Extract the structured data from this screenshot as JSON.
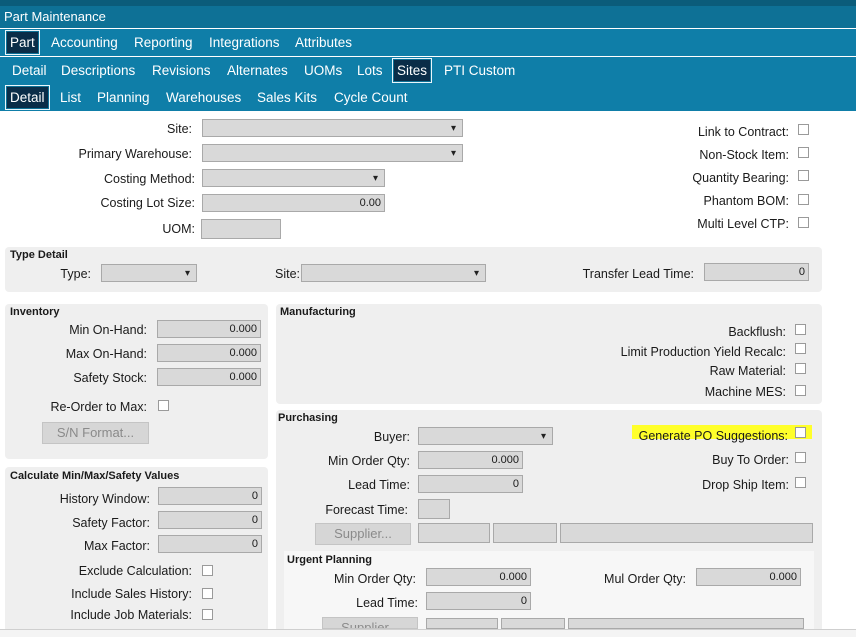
{
  "window": {
    "title": "Part Maintenance"
  },
  "tabs_level1": [
    "Part",
    "Accounting",
    "Reporting",
    "Integrations",
    "Attributes"
  ],
  "tabs_level2": [
    "Detail",
    "Descriptions",
    "Revisions",
    "Alternates",
    "UOMs",
    "Lots",
    "Sites",
    "PTI Custom"
  ],
  "tabs_level3": [
    "Detail",
    "List",
    "Planning",
    "Warehouses",
    "Sales Kits",
    "Cycle Count"
  ],
  "top": {
    "site_label": "Site:",
    "primary_warehouse_label": "Primary Warehouse:",
    "costing_method_label": "Costing Method:",
    "costing_lot_size_label": "Costing Lot Size:",
    "costing_lot_size_value": "0.00",
    "uom_label": "UOM:",
    "checks": [
      "Link to Contract:",
      "Non-Stock Item:",
      "Quantity Bearing:",
      "Phantom BOM:",
      "Multi Level CTP:"
    ]
  },
  "type_detail": {
    "title": "Type Detail",
    "type_label": "Type:",
    "site_label": "Site:",
    "transfer_lead_time_label": "Transfer Lead Time:",
    "transfer_lead_time_value": "0"
  },
  "inventory": {
    "title": "Inventory",
    "min_on_hand_label": "Min On-Hand:",
    "min_on_hand_value": "0.000",
    "max_on_hand_label": "Max On-Hand:",
    "max_on_hand_value": "0.000",
    "safety_stock_label": "Safety Stock:",
    "safety_stock_value": "0.000",
    "reorder_label": "Re-Order to Max:",
    "sn_format_button": "S/N Format..."
  },
  "manufacturing": {
    "title": "Manufacturing",
    "checks": [
      "Backflush:",
      "Limit Production Yield Recalc:",
      "Raw Material:",
      "Machine MES:"
    ]
  },
  "calc": {
    "title": "Calculate Min/Max/Safety Values",
    "history_window_label": "History Window:",
    "history_window_value": "0",
    "safety_factor_label": "Safety Factor:",
    "safety_factor_value": "0",
    "max_factor_label": "Max Factor:",
    "max_factor_value": "0",
    "exclude_label": "Exclude Calculation:",
    "sales_history_label": "Include Sales History:",
    "job_materials_label": "Include Job Materials:"
  },
  "purchasing": {
    "title": "Purchasing",
    "buyer_label": "Buyer:",
    "min_order_qty_label": "Min Order Qty:",
    "min_order_qty_value": "0.000",
    "lead_time_label": "Lead Time:",
    "lead_time_value": "0",
    "forecast_time_label": "Forecast Time:",
    "supplier_button": "Supplier...",
    "generate_po_label": "Generate PO Suggestions:",
    "buy_to_order_label": "Buy To Order:",
    "drop_ship_label": "Drop Ship Item:"
  },
  "urgent": {
    "title": "Urgent Planning",
    "min_order_qty_label": "Min Order Qty:",
    "min_order_qty_value": "0.000",
    "mul_order_qty_label": "Mul Order Qty:",
    "mul_order_qty_value": "0.000",
    "lead_time_label": "Lead Time:",
    "lead_time_value": "0",
    "supplier_button": "Supplier..."
  },
  "colors": {
    "tab_bar": "#0f7ea8",
    "title_bar": "#0e7196",
    "active_tab": "#0a2d48",
    "highlight": "#ffff2a"
  }
}
